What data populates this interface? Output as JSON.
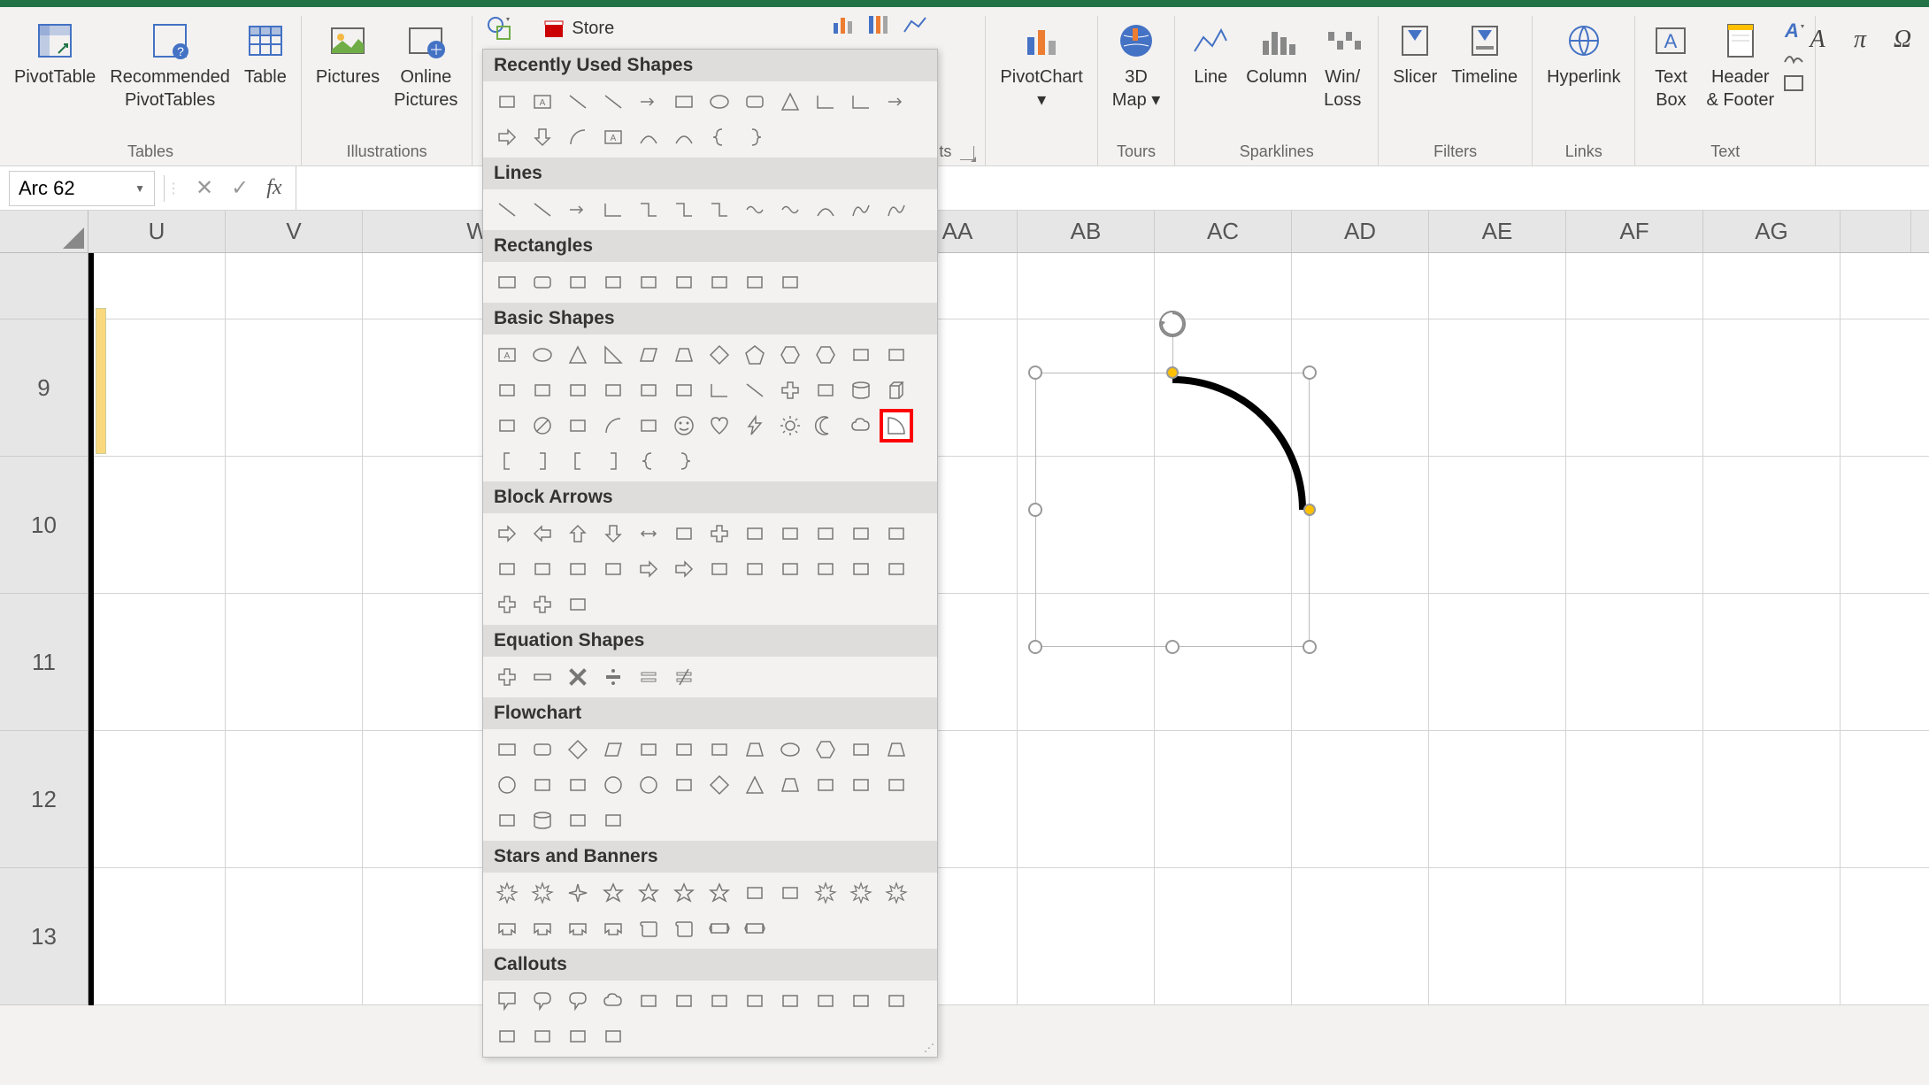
{
  "ribbon": {
    "groups": {
      "tables": {
        "label": "Tables",
        "pivot": "PivotTable",
        "recommended": "Recommended\nPivotTables",
        "table": "Table"
      },
      "illustrations": {
        "label": "Illustrations",
        "pictures": "Pictures",
        "online": "Online\nPictures"
      },
      "addins": {
        "store": "Store"
      },
      "charts": {
        "pivot_chart": "PivotChart"
      },
      "tours": {
        "label": "Tours",
        "map": "3D\nMap ▾"
      },
      "sparklines": {
        "label": "Sparklines",
        "line": "Line",
        "column": "Column",
        "winloss": "Win/\nLoss"
      },
      "filters": {
        "label": "Filters",
        "slicer": "Slicer",
        "timeline": "Timeline"
      },
      "links": {
        "label": "Links",
        "hyperlink": "Hyperlink"
      },
      "text": {
        "label": "Text",
        "textbox": "Text\nBox",
        "header": "Header\n& Footer"
      }
    }
  },
  "namebox": {
    "value": "Arc 62"
  },
  "columns": [
    "U",
    "V",
    "W",
    "AA",
    "AB",
    "AC",
    "AD",
    "AE",
    "AF",
    "AG"
  ],
  "rows": [
    "9",
    "10",
    "11",
    "12",
    "13"
  ],
  "shapes_panel": {
    "sections": {
      "recent": "Recently Used Shapes",
      "lines": "Lines",
      "rectangles": "Rectangles",
      "basic": "Basic Shapes",
      "block": "Block Arrows",
      "equation": "Equation Shapes",
      "flowchart": "Flowchart",
      "stars": "Stars and Banners",
      "callouts": "Callouts"
    }
  },
  "right_symbols": [
    "A",
    "π",
    "Ω"
  ]
}
